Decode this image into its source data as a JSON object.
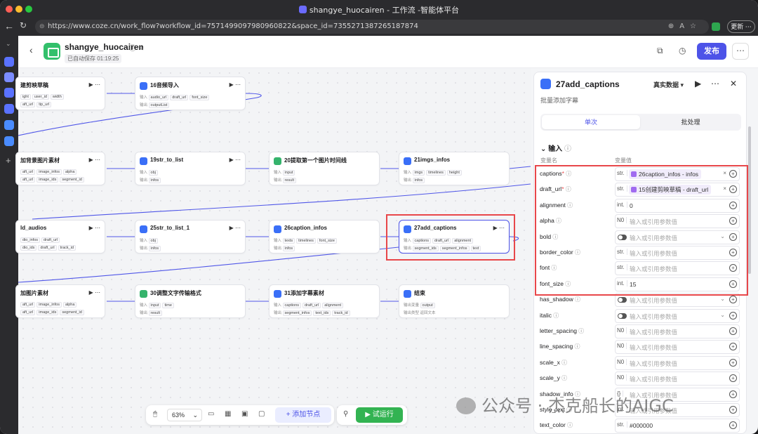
{
  "browser": {
    "window_title": "shangye_huocairen - 工作流 -智能体平台",
    "url": "https://www.coze.cn/work_flow?workflow_id=7571499097980960822&space_id=7355271387265187874",
    "update_button": "更新 ⋯"
  },
  "header": {
    "app_name": "shangye_huocairen",
    "autosave": "已自动保存 01:19:25",
    "publish_label": "发布",
    "more_label": "⋯"
  },
  "canvas": {
    "nodes": [
      {
        "title": "建剪映草稿",
        "rows": [
          [
            "ight",
            "user_id",
            "width"
          ],
          [
            "aft_url",
            "tip_url"
          ]
        ]
      },
      {
        "title": "16音频导入",
        "rows": [
          [
            "输入",
            "audio_url",
            "draft_url",
            "font_size"
          ],
          [
            "输出",
            "outputList"
          ]
        ]
      },
      {
        "title": "加背景图片素材",
        "rows": [
          [
            "aft_url",
            "image_infos",
            "alpha"
          ],
          [
            "aft_url",
            "image_ids",
            "segment_id"
          ]
        ]
      },
      {
        "title": "19str_to_list",
        "rows": [
          [
            "输入",
            "obj"
          ],
          [
            "输出",
            "infos"
          ]
        ]
      },
      {
        "title": "20提取第一个图片时间线",
        "rows": [
          [
            "输入",
            "input"
          ],
          [
            "输出",
            "result"
          ]
        ]
      },
      {
        "title": "21imgs_infos",
        "rows": [
          [
            "输入",
            "imgs",
            "timelines",
            "height",
            "in_an"
          ],
          [
            "输出",
            "infos"
          ]
        ]
      },
      {
        "title": "ld_audios",
        "rows": [
          [
            "dio_infos",
            "draft_url"
          ],
          [
            "dio_ids",
            "draft_url",
            "track_id"
          ]
        ]
      },
      {
        "title": "25str_to_list_1",
        "rows": [
          [
            "输入",
            "obj"
          ],
          [
            "输出",
            "infos"
          ]
        ]
      },
      {
        "title": "26caption_infos",
        "rows": [
          [
            "输入",
            "texts",
            "timelines",
            "font_size",
            "tr"
          ],
          [
            "输出",
            "infos"
          ]
        ]
      },
      {
        "title": "27add_captions",
        "rows": [
          [
            "输入",
            "captions",
            "draft_url",
            "alignment",
            "..."
          ],
          [
            "输出",
            "segment_ids",
            "segment_infos",
            "text"
          ]
        ]
      },
      {
        "title": "加图片素材",
        "rows": [
          [
            "aft_url",
            "image_infos",
            "alpha"
          ],
          [
            "aft_url",
            "image_ids",
            "segment_id"
          ]
        ]
      },
      {
        "title": "30调整文字传输格式",
        "rows": [
          [
            "输入",
            "input",
            "time"
          ],
          [
            "输出",
            "result"
          ]
        ]
      },
      {
        "title": "31添加字幕素材",
        "rows": [
          [
            "输入",
            "captions",
            "draft_url",
            "alignment"
          ],
          [
            "输出",
            "segment_infos",
            "text_ids",
            "track_id"
          ]
        ]
      },
      {
        "title": "结束",
        "rows": [
          [
            "输出变量",
            "output"
          ],
          [
            "输出类型",
            "返回文本"
          ]
        ]
      }
    ]
  },
  "toolbar": {
    "zoom": "63%",
    "add_node": "+ 添加节点",
    "run": "▶ 试运行"
  },
  "panel": {
    "title": "27add_captions",
    "real_data": "真实数据 ▾",
    "subtitle": "批量添加字幕",
    "tab_single": "单次",
    "tab_batch": "批处理",
    "section_input": "输入",
    "col_name": "变量名",
    "col_value": "变量值",
    "params": [
      {
        "name": "captions",
        "required": true,
        "type": "str.",
        "mode": "ref",
        "value": "26caption_infos - infos"
      },
      {
        "name": "draft_url",
        "required": true,
        "type": "str.",
        "mode": "ref",
        "value": "15创建剪映草稿 - draft_url"
      },
      {
        "name": "alignment",
        "required": false,
        "type": "int.",
        "mode": "text",
        "value": "0"
      },
      {
        "name": "alpha",
        "required": false,
        "type": "N0",
        "mode": "placeholder",
        "value": "输入或引用参数值"
      },
      {
        "name": "bold",
        "required": false,
        "type": "toggle",
        "mode": "placeholder",
        "value": "输入或引用参数值"
      },
      {
        "name": "border_color",
        "required": false,
        "type": "str.",
        "mode": "placeholder",
        "value": "输入或引用参数值"
      },
      {
        "name": "font",
        "required": false,
        "type": "str.",
        "mode": "placeholder",
        "value": "输入或引用参数值"
      },
      {
        "name": "font_size",
        "required": false,
        "type": "int.",
        "mode": "text",
        "value": "15"
      },
      {
        "name": "has_shadow",
        "required": false,
        "type": "toggle",
        "mode": "placeholder",
        "value": "输入或引用参数值"
      },
      {
        "name": "italic",
        "required": false,
        "type": "toggle",
        "mode": "placeholder",
        "value": "输入或引用参数值"
      },
      {
        "name": "letter_spacing",
        "required": false,
        "type": "N0",
        "mode": "placeholder",
        "value": "输入或引用参数值"
      },
      {
        "name": "line_spacing",
        "required": false,
        "type": "N0",
        "mode": "placeholder",
        "value": "输入或引用参数值"
      },
      {
        "name": "scale_x",
        "required": false,
        "type": "N0",
        "mode": "placeholder",
        "value": "输入或引用参数值"
      },
      {
        "name": "scale_y",
        "required": false,
        "type": "N0",
        "mode": "placeholder",
        "value": "输入或引用参数值"
      },
      {
        "name": "shadow_info",
        "required": false,
        "type": "{}",
        "mode": "placeholder",
        "value": "输入或引用参数值"
      },
      {
        "name": "style_text",
        "required": false,
        "type": "int.",
        "mode": "placeholder",
        "value": "输入或引用参数值"
      },
      {
        "name": "text_color",
        "required": false,
        "type": "str.",
        "mode": "text",
        "value": "#000000"
      }
    ]
  },
  "watermark": "公众号 · 杰克船长的AIGC",
  "colors": {
    "accent": "#4d53e8",
    "highlight": "#e8474a",
    "run": "#33b352"
  }
}
